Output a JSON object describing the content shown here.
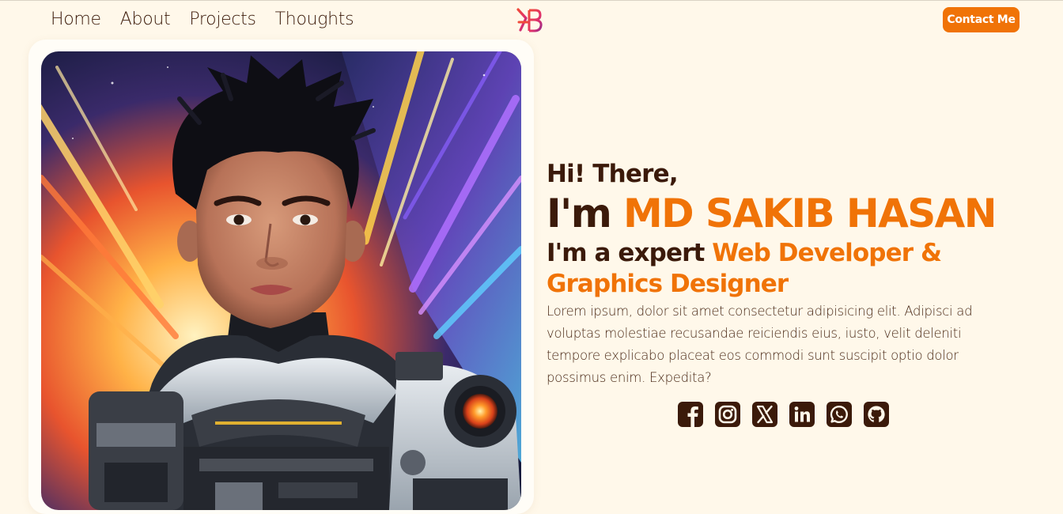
{
  "nav": {
    "links": [
      "Home",
      "About",
      "Projects",
      "Thoughts"
    ],
    "contact_label": "Contact Me"
  },
  "hero": {
    "greeting": "Hi! There,",
    "intro_prefix": "I'm",
    "name": "MD SAKIB HASAN",
    "role_prefix": "I'm a expert",
    "role": "Web Developer & Graphics Designer",
    "bio": "Lorem ipsum, dolor sit amet consectetur adipisicing elit. Adipisci ad voluptas molestiae recusandae reiciendis eius, iusto, velit deleniti tempore explicabo placeat eos commodi sunt suscipit optio dolor possimus enim. Expedita?"
  },
  "social": [
    "facebook-icon",
    "instagram-icon",
    "x-twitter-icon",
    "linkedin-icon",
    "whatsapp-icon",
    "github-icon"
  ],
  "colors": {
    "background": "#fff8ea",
    "accent": "#f07307",
    "text": "#3b1a0a"
  }
}
